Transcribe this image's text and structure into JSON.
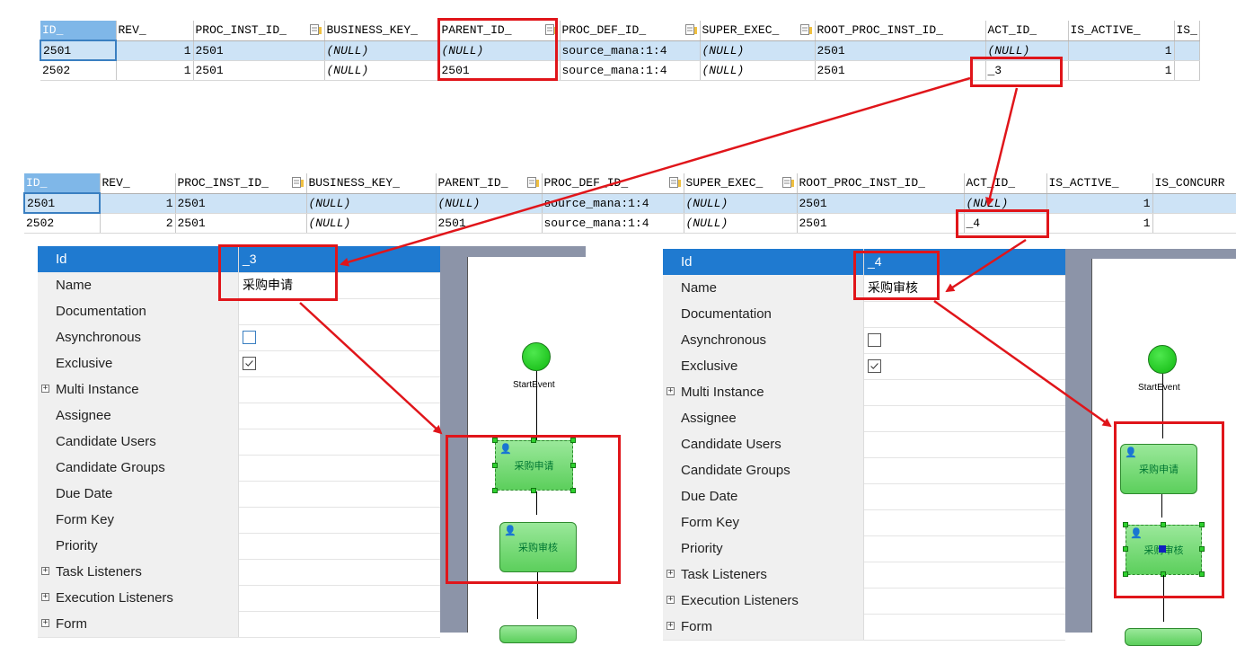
{
  "grid_top": {
    "columns": [
      "ID_",
      "REV_",
      "PROC_INST_ID_",
      "BUSINESS_KEY_",
      "PARENT_ID_",
      "PROC_DEF_ID_",
      "SUPER_EXEC_",
      "ROOT_PROC_INST_ID_",
      "ACT_ID_",
      "IS_ACTIVE_",
      "IS_"
    ],
    "rows": [
      [
        "2501",
        "1",
        "2501",
        "(NULL)",
        "(NULL)",
        "source_mana:1:4",
        "(NULL)",
        "2501",
        "(NULL)",
        "1",
        ""
      ],
      [
        "2502",
        "1",
        "2501",
        "(NULL)",
        "2501",
        "source_mana:1:4",
        "(NULL)",
        "2501",
        "_3",
        "1",
        ""
      ]
    ]
  },
  "grid_mid": {
    "columns": [
      "ID_",
      "REV_",
      "PROC_INST_ID_",
      "BUSINESS_KEY_",
      "PARENT_ID_",
      "PROC_DEF_ID_",
      "SUPER_EXEC_",
      "ROOT_PROC_INST_ID_",
      "ACT_ID_",
      "IS_ACTIVE_",
      "IS_CONCURR"
    ],
    "rows": [
      [
        "2501",
        "1",
        "2501",
        "(NULL)",
        "(NULL)",
        "source_mana:1:4",
        "(NULL)",
        "2501",
        "(NULL)",
        "1",
        ""
      ],
      [
        "2502",
        "2",
        "2501",
        "(NULL)",
        "2501",
        "source_mana:1:4",
        "(NULL)",
        "2501",
        "_4",
        "1",
        ""
      ]
    ]
  },
  "props_left": {
    "rows": [
      {
        "key": "Id",
        "value": "_3"
      },
      {
        "key": "Name",
        "value": "采购申请"
      },
      {
        "key": "Documentation",
        "value": ""
      },
      {
        "key": "Asynchronous",
        "value": ""
      },
      {
        "key": "Exclusive",
        "value": ""
      },
      {
        "key": "Multi Instance",
        "value": ""
      },
      {
        "key": "Assignee",
        "value": ""
      },
      {
        "key": "Candidate Users",
        "value": ""
      },
      {
        "key": "Candidate Groups",
        "value": ""
      },
      {
        "key": "Due Date",
        "value": ""
      },
      {
        "key": "Form Key",
        "value": ""
      },
      {
        "key": "Priority",
        "value": ""
      },
      {
        "key": "Task Listeners",
        "value": ""
      },
      {
        "key": "Execution Listeners",
        "value": ""
      },
      {
        "key": "Form",
        "value": ""
      }
    ]
  },
  "props_right": {
    "rows": [
      {
        "key": "Id",
        "value": "_4"
      },
      {
        "key": "Name",
        "value": "采购审核"
      },
      {
        "key": "Documentation",
        "value": ""
      },
      {
        "key": "Asynchronous",
        "value": ""
      },
      {
        "key": "Exclusive",
        "value": ""
      },
      {
        "key": "Multi Instance",
        "value": ""
      },
      {
        "key": "Assignee",
        "value": ""
      },
      {
        "key": "Candidate Users",
        "value": ""
      },
      {
        "key": "Candidate Groups",
        "value": ""
      },
      {
        "key": "Due Date",
        "value": ""
      },
      {
        "key": "Form Key",
        "value": ""
      },
      {
        "key": "Priority",
        "value": ""
      },
      {
        "key": "Task Listeners",
        "value": ""
      },
      {
        "key": "Execution Listeners",
        "value": ""
      },
      {
        "key": "Form",
        "value": ""
      }
    ]
  },
  "diagram_left": {
    "start_label": "StartEvent",
    "task1": "采购申请",
    "task2": "采购审核"
  },
  "diagram_right": {
    "start_label": "StartEvent",
    "task1": "采购申请",
    "task2": "采购审核"
  },
  "colors": {
    "highlight_red": "#e0151a",
    "selection_blue": "#1f7ad0",
    "task_green": "#5ccf5c"
  }
}
